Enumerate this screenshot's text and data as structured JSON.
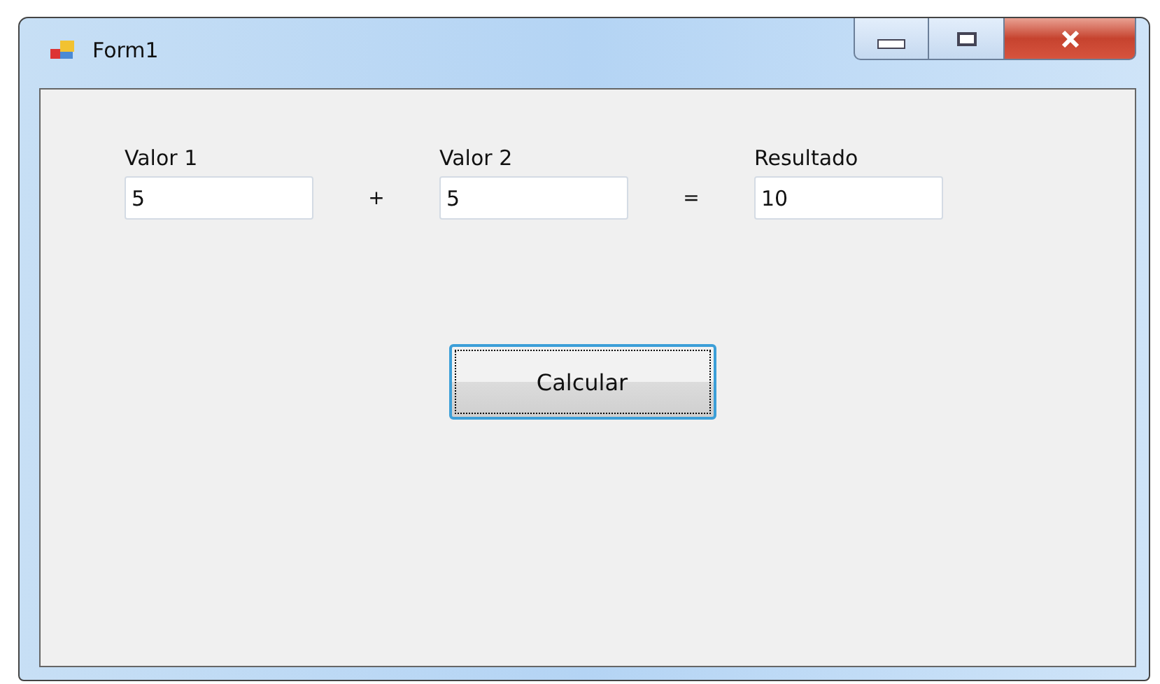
{
  "window": {
    "title": "Form1"
  },
  "fields": [
    {
      "label": "Valor 1",
      "value": "5",
      "operator": "+"
    },
    {
      "label": "Valor 2",
      "value": "5",
      "operator": "="
    },
    {
      "label": "Resultado",
      "value": "10"
    }
  ],
  "button": {
    "label": "Calcular",
    "focused": true
  }
}
